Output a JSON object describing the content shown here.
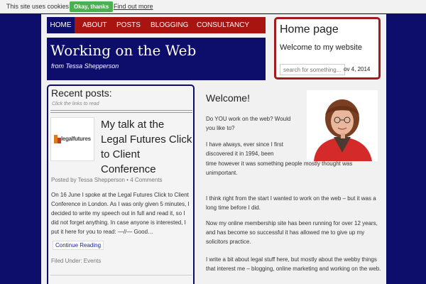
{
  "cookie_bar": {
    "text": "This site uses cookies",
    "ok_label": "Okay, thanks",
    "more_label": "Find out more"
  },
  "nav": {
    "items": [
      {
        "label": "HOME",
        "active": true
      },
      {
        "label": "ABOUT"
      },
      {
        "label": "POSTS"
      },
      {
        "label": "BLOGGING"
      },
      {
        "label": "CONSULTANCY"
      }
    ]
  },
  "header": {
    "title": "Working on the Web",
    "subtitle": "from Tessa Shepperson"
  },
  "home_widget": {
    "title": "Home page",
    "welcome": "Welcome to my website",
    "search_placeholder": "search for something...",
    "date": "ov 4, 2014"
  },
  "recent_posts": {
    "title": "Recent posts:",
    "hint": "Click the links to read",
    "post": {
      "logo_text": "legalfutures",
      "title": "My talk at the Legal Futures Click to Client Conference",
      "meta_prefix": "Posted by",
      "author": "Tessa Shepperson",
      "separator": "•",
      "comments": "4 Comments",
      "excerpt": "On 16 June I spoke at the Legal Futures Click to Client Conference in London. As I was only given 5 minutes, I decided to write my speech out in full and read it, so I did not forget anything. In case anyone is interested, I put it here for you to read: —//— Good…",
      "continue_label": "Continue Reading",
      "filed_under": "Filed Under: Events"
    }
  },
  "main": {
    "welcome_title": "Welcome!",
    "paragraphs": [
      "Do YOU work on the web?  Would you like to?",
      "I have always, ever since I first discovered it in 1994, been fascinated by the web.  For a long time however it was something people mostly thought was unimportant.",
      "I think right from the start I wanted to work on the web – but it was a long time before I did.",
      "Now my online membership site has been running for over 12 years, and has become so successful it has allowed me to give up my solicitors practice.",
      "I write a bit about legal stuff here, but mostly about the webby things that interest me – blogging, online marketing and working on the web."
    ]
  },
  "colors": {
    "navy": "#0d0d6b",
    "nav_red": "#a8140f",
    "cookie_green": "#4caf50",
    "link_blue": "#1b1b9e"
  }
}
